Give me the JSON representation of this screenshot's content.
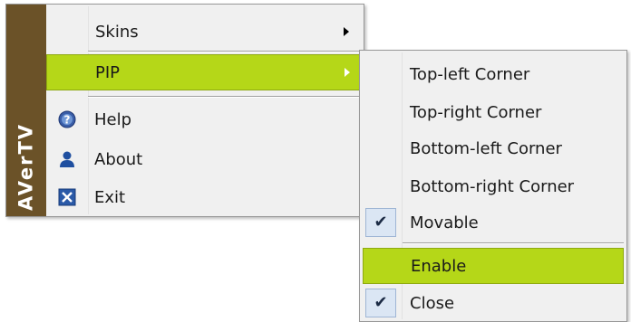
{
  "main_menu": {
    "brand": "AVerTV",
    "items": [
      {
        "label": "Skins",
        "icon": "none",
        "submenu": true
      },
      {
        "label": "PIP",
        "icon": "none",
        "submenu": true,
        "highlighted": true
      },
      {
        "label": "Help",
        "icon": "help-icon"
      },
      {
        "label": "About",
        "icon": "user-icon"
      },
      {
        "label": "Exit",
        "icon": "close-icon"
      }
    ]
  },
  "pip_submenu": {
    "items": [
      {
        "label": "Top-left Corner"
      },
      {
        "label": "Top-right Corner"
      },
      {
        "label": "Bottom-left Corner"
      },
      {
        "label": "Bottom-right Corner"
      },
      {
        "label": "Movable",
        "checked": true
      },
      {
        "label": "Enable",
        "highlighted": true
      },
      {
        "label": "Close",
        "checked": true
      }
    ],
    "check_glyph": "✔"
  },
  "colors": {
    "highlight": "#b5d718",
    "brand_strip": "#6b5228",
    "menu_background": "#f0f0f0"
  }
}
